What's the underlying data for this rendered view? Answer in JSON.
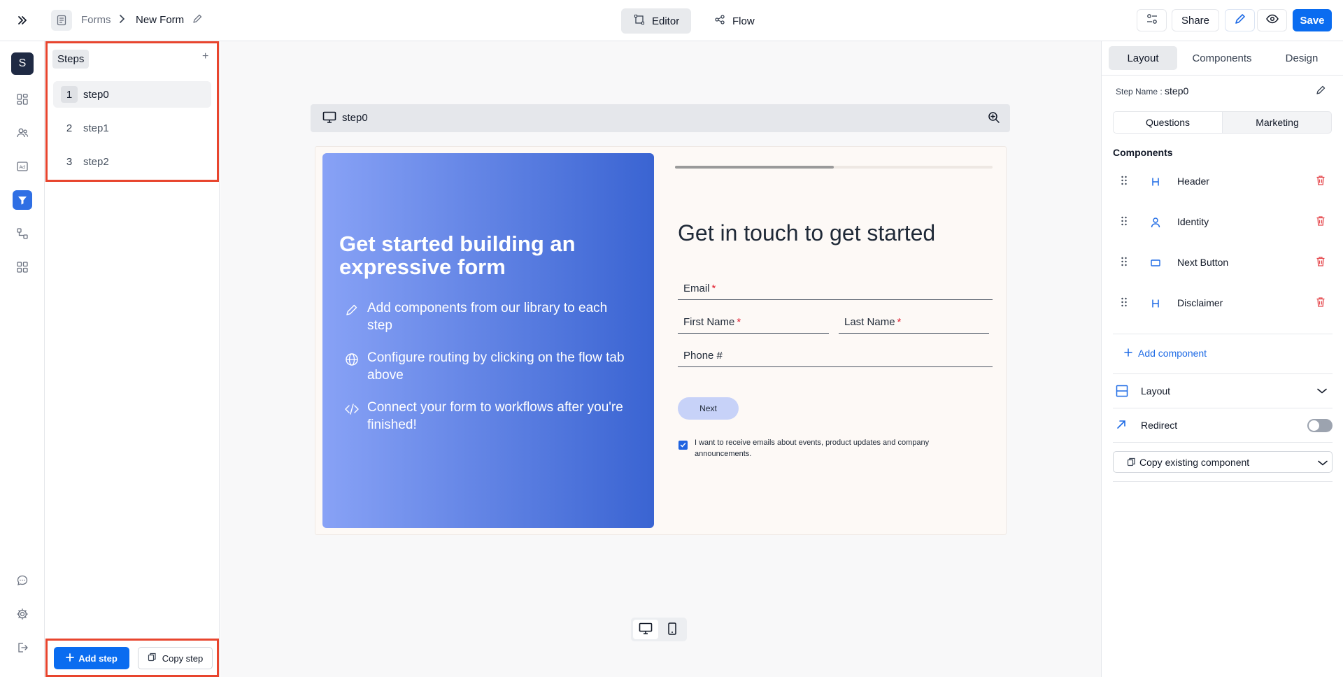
{
  "header": {
    "breadcrumb_root": "Forms",
    "form_title": "New Form",
    "modes": [
      {
        "label": "Editor",
        "active": true
      },
      {
        "label": "Flow",
        "active": false
      }
    ],
    "share_label": "Share",
    "save_label": "Save"
  },
  "rail": {
    "avatar_letter": "S",
    "items": [
      "dashboard-icon",
      "contacts-icon",
      "ads-icon",
      "forms-icon",
      "workflows-icon",
      "apps-icon",
      "chat-icon",
      "settings-icon",
      "logout-icon"
    ],
    "active_item": "forms-icon"
  },
  "steps": {
    "title": "Steps",
    "add_symbol": "+",
    "items": [
      {
        "num": "1",
        "name": "step0",
        "active": true
      },
      {
        "num": "2",
        "name": "step1",
        "active": false
      },
      {
        "num": "3",
        "name": "step2",
        "active": false
      }
    ],
    "add_step_label": "Add step",
    "copy_step_label": "Copy step"
  },
  "canvas": {
    "preview_title": "step0",
    "hero": {
      "title": "Get started building an expressive form",
      "items": [
        {
          "icon": "pencil-icon",
          "text": "Add components from our library to each step"
        },
        {
          "icon": "globe-icon",
          "text": "Configure routing by clicking on the flow tab above"
        },
        {
          "icon": "code-icon",
          "text": "Connect your form to workflows after you're finished!"
        }
      ]
    },
    "progress": 0.5,
    "form": {
      "heading": "Get in touch to get started",
      "fields": {
        "email": "Email",
        "first_name": "First Name",
        "last_name": "Last Name",
        "phone": "Phone #"
      },
      "required_mark": "*",
      "next_label": "Next",
      "consent_checked": true,
      "consent_text": "I want to receive emails about events, product updates and company announcements."
    }
  },
  "right_panel": {
    "tabs": [
      {
        "label": "Layout",
        "active": true
      },
      {
        "label": "Components",
        "active": false
      },
      {
        "label": "Design",
        "active": false
      }
    ],
    "step_name_label": "Step Name :",
    "step_name_value": "step0",
    "segments": [
      {
        "label": "Questions",
        "active": true
      },
      {
        "label": "Marketing",
        "active": false
      }
    ],
    "components_title": "Components",
    "components": [
      {
        "label": "Header",
        "icon": "heading-icon"
      },
      {
        "label": "Identity",
        "icon": "person-icon"
      },
      {
        "label": "Next Button",
        "icon": "button-icon"
      },
      {
        "label": "Disclaimer",
        "icon": "heading-icon"
      }
    ],
    "add_component_label": "Add component",
    "layout_label": "Layout",
    "redirect_label": "Redirect",
    "redirect_enabled": false,
    "copy_existing_label": "Copy existing component"
  },
  "colors": {
    "primary": "#0a6cf0",
    "highlight_border": "#e8452e",
    "hero_gradient_start": "#88a2f6",
    "hero_gradient_end": "#3a64d2",
    "danger": "#e5484d"
  }
}
